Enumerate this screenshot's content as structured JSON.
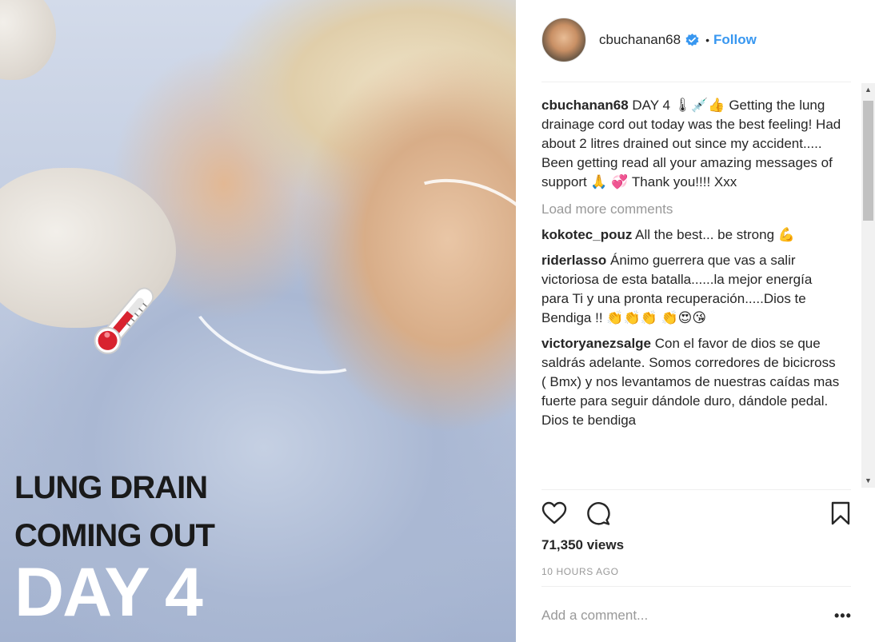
{
  "media": {
    "overlay_lines": [
      "LUNG DRAIN",
      "COMING OUT",
      "DAY 4"
    ]
  },
  "header": {
    "username": "cbuchanan68",
    "separator": "•",
    "follow_label": "Follow"
  },
  "caption": {
    "username": "cbuchanan68",
    "text": "DAY 4 🌡💉👍 Getting the lung drainage cord out today was the best feeling! Had about 2 litres drained out since my accident..... Been getting read all your amazing messages of support 🙏 💞 Thank you!!!! Xxx"
  },
  "load_more_label": "Load more comments",
  "comments": [
    {
      "username": "kokotec_pouz",
      "text": "All the best... be strong 💪"
    },
    {
      "username": "riderlasso",
      "text": "Ánimo guerrera que vas a salir victoriosa de esta batalla......la mejor energía para Ti y una pronta recuperación.....Dios te Bendiga !! 👏👏👏 👏😍😘"
    },
    {
      "username": "victoryanezsalge",
      "text": "Con el favor de dios se que saldrás adelante. Somos corredores de bicicross ( Bmx) y nos levantamos de nuestras caídas mas fuerte para seguir dándole duro, dándole pedal. Dios te bendiga"
    }
  ],
  "views": "71,350 views",
  "time_ago": "10 HOURS AGO",
  "add_comment_placeholder": "Add a comment...",
  "more_options": "•••",
  "colors": {
    "follow": "#3897f0",
    "verified": "#3897f0",
    "muted": "#999999",
    "text": "#262626"
  },
  "icons": [
    "verified-badge-icon",
    "heart-icon",
    "comment-icon",
    "bookmark-icon",
    "thermometer-sticker-icon"
  ]
}
